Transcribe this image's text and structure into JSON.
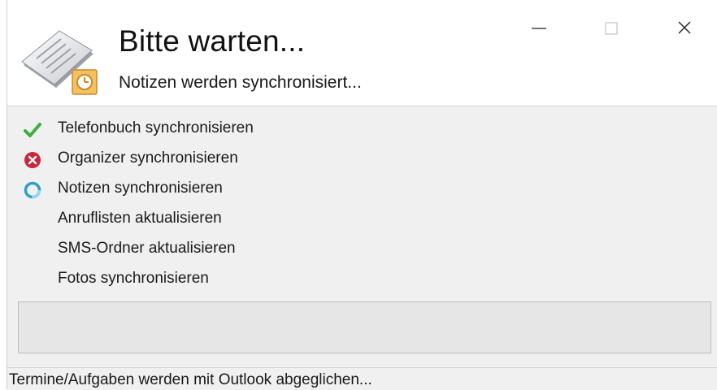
{
  "dialog": {
    "title": "Bitte warten...",
    "subtitle": "Notizen werden synchronisiert..."
  },
  "window_controls": {
    "minimize_icon": "minimize-icon",
    "maximize_icon": "maximize-icon",
    "close_icon": "close-icon"
  },
  "tasks": [
    {
      "label": "Telefonbuch synchronisieren",
      "status": "done",
      "icon": "checkmark-icon"
    },
    {
      "label": "Organizer synchronisieren",
      "status": "error",
      "icon": "error-icon"
    },
    {
      "label": "Notizen synchronisieren",
      "status": "in-progress",
      "icon": "spinner-icon"
    },
    {
      "label": "Anruflisten aktualisieren",
      "status": "pending",
      "icon": ""
    },
    {
      "label": "SMS-Ordner aktualisieren",
      "status": "pending",
      "icon": ""
    },
    {
      "label": "Fotos synchronisieren",
      "status": "pending",
      "icon": ""
    }
  ],
  "progress": {
    "fraction": 0
  },
  "statusbar": {
    "text": "Termine/Aufgaben werden mit Outlook abgeglichen..."
  },
  "colors": {
    "done": "#3cae3c",
    "error": "#c8283c",
    "in_progress": "#2aa0c8",
    "accent_clock": "#e8a53a"
  }
}
